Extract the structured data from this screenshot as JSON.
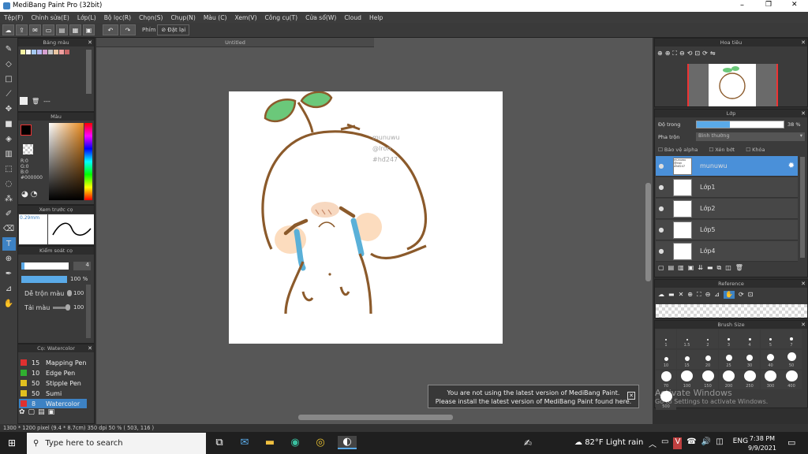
{
  "window": {
    "title": "MediBang Paint Pro (32bit)",
    "minimize": "–",
    "maximize": "❐",
    "close": "✕"
  },
  "menu": [
    "Tệp(F)",
    "Chỉnh sửa(E)",
    "Lớp(L)",
    "Bộ lọc(R)",
    "Chọn(S)",
    "Chụp(N)",
    "Màu (C)",
    "Xem(V)",
    "Công cụ(T)",
    "Cửa sổ(W)",
    "Cloud",
    "Help"
  ],
  "toolbar": {
    "shortcut_label": "Phím",
    "reset_label": "Đặt lại"
  },
  "document": {
    "tab_title": "Untitled"
  },
  "palette_panel": {
    "title": "Bảng màu",
    "swatches": [
      "#f6f3a4",
      "#f7f7f7",
      "#a4c8f0",
      "#b6b6f0",
      "#d6a0d0",
      "#c4c4c4",
      "#e8c4a0",
      "#f0a0a0",
      "#c86868"
    ],
    "swatch_label": "---"
  },
  "color_panel": {
    "title": "Màu",
    "r": "R:0",
    "g": "G:0",
    "b": "B:0",
    "hex": "#000000"
  },
  "brush_preview": {
    "title": "Xem trước cọ",
    "size": "0.29mm"
  },
  "brush_control": {
    "title": "Kiểm soát cọ",
    "width_value": "4",
    "opacity_value": "100 %",
    "blend_label": "Dễ trộn màu",
    "blend_value": "100",
    "reload_label": "Tải màu",
    "reload_value": "100"
  },
  "brush_list": {
    "title": "Cọ: Watercolor",
    "items": [
      {
        "size": "15",
        "name": "Mapping Pen",
        "color": "#e03030"
      },
      {
        "size": "10",
        "name": "Edge Pen",
        "color": "#30b030"
      },
      {
        "size": "50",
        "name": "Stipple Pen",
        "color": "#e0c020"
      },
      {
        "size": "50",
        "name": "Sumi",
        "color": "#e0c020"
      },
      {
        "size": "8",
        "name": "Watercolor",
        "color": "#e03030"
      }
    ]
  },
  "navigator": {
    "title": "Hoa tiêu"
  },
  "layer_panel": {
    "title": "Lớp",
    "opacity_label": "Độ trong",
    "opacity_value": "38 %",
    "opacity_fraction": 0.38,
    "blend_label": "Pha trộn",
    "blend_value": "Bình thường",
    "protect_alpha": "Bảo vệ alpha",
    "clipping": "Xén bớt",
    "lock": "Khóa",
    "layers": [
      {
        "name": "munuwu",
        "thumb_text": "munuwu @Iron #hđ247"
      },
      {
        "name": "Lớp1"
      },
      {
        "name": "Lớp2"
      },
      {
        "name": "Lớp5"
      },
      {
        "name": "Lớp4"
      }
    ]
  },
  "reference_panel": {
    "title": "Reference"
  },
  "brush_size_panel": {
    "title": "Brush Size",
    "sizes": [
      "1",
      "1.5",
      "2",
      "3",
      "4",
      "5",
      "7",
      "10",
      "15",
      "20",
      "25",
      "30",
      "40",
      "50",
      "70",
      "100",
      "150",
      "200",
      "250",
      "300",
      "400",
      "500"
    ]
  },
  "canvas_watermark": {
    "line1": "munuwu",
    "line2": "@Iron",
    "line3": "#hđ247"
  },
  "notification": {
    "line1": "You are not using the latest version of MediBang Paint.",
    "line2": "Please install the latest version of MediBang Paint found here."
  },
  "activation": {
    "line1": "Activate Windows",
    "line2": "Go to Settings to activate Windows."
  },
  "statusbar": {
    "text": "1300 * 1200 pixel   (9.4 * 8.7cm)   350 dpi   50 %   ( 503, 116 )"
  },
  "taskbar": {
    "search_placeholder": "Type here to search",
    "weather": "82°F  Light rain",
    "lang": "ENG",
    "time": "7:38 PM",
    "date": "9/9/2021"
  }
}
